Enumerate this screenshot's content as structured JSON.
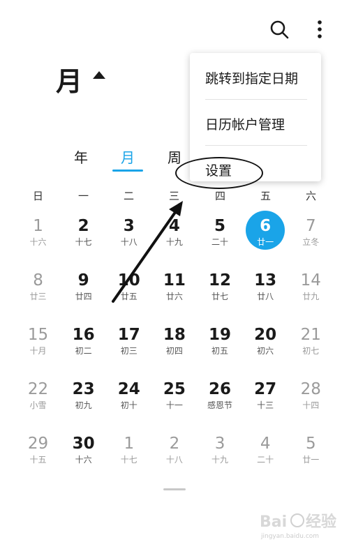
{
  "header": {
    "month_label": "月",
    "icons": [
      "search-icon",
      "more-vert-icon",
      "dropdown-caret-icon"
    ]
  },
  "view_tabs": [
    {
      "label": "年",
      "active": false
    },
    {
      "label": "月",
      "active": true
    },
    {
      "label": "周",
      "active": false
    }
  ],
  "weekdays": [
    "日",
    "一",
    "二",
    "三",
    "四",
    "五",
    "六"
  ],
  "menu": {
    "items": [
      "跳转到指定日期",
      "日历帐户管理",
      "设置"
    ]
  },
  "calendar": {
    "weeks": [
      [
        {
          "day": "1",
          "sub": "十六",
          "muted": true
        },
        {
          "day": "2",
          "sub": "十七"
        },
        {
          "day": "3",
          "sub": "十八"
        },
        {
          "day": "4",
          "sub": "十九"
        },
        {
          "day": "5",
          "sub": "二十"
        },
        {
          "day": "6",
          "sub": "廿一",
          "today": true
        },
        {
          "day": "7",
          "sub": "立冬",
          "muted": true
        }
      ],
      [
        {
          "day": "8",
          "sub": "廿三",
          "muted": true
        },
        {
          "day": "9",
          "sub": "廿四"
        },
        {
          "day": "10",
          "sub": "廿五"
        },
        {
          "day": "11",
          "sub": "廿六"
        },
        {
          "day": "12",
          "sub": "廿七"
        },
        {
          "day": "13",
          "sub": "廿八"
        },
        {
          "day": "14",
          "sub": "廿九",
          "muted": true
        }
      ],
      [
        {
          "day": "15",
          "sub": "十月",
          "muted": true
        },
        {
          "day": "16",
          "sub": "初二"
        },
        {
          "day": "17",
          "sub": "初三"
        },
        {
          "day": "18",
          "sub": "初四"
        },
        {
          "day": "19",
          "sub": "初五"
        },
        {
          "day": "20",
          "sub": "初六"
        },
        {
          "day": "21",
          "sub": "初七",
          "muted": true
        }
      ],
      [
        {
          "day": "22",
          "sub": "小雪",
          "muted": true
        },
        {
          "day": "23",
          "sub": "初九"
        },
        {
          "day": "24",
          "sub": "初十"
        },
        {
          "day": "25",
          "sub": "十一"
        },
        {
          "day": "26",
          "sub": "感恩节"
        },
        {
          "day": "27",
          "sub": "十三"
        },
        {
          "day": "28",
          "sub": "十四",
          "muted": true
        }
      ],
      [
        {
          "day": "29",
          "sub": "十五",
          "muted": true
        },
        {
          "day": "30",
          "sub": "十六"
        },
        {
          "day": "1",
          "sub": "十七",
          "muted": true
        },
        {
          "day": "2",
          "sub": "十八",
          "muted": true
        },
        {
          "day": "3",
          "sub": "十九",
          "muted": true
        },
        {
          "day": "4",
          "sub": "二十",
          "muted": true
        },
        {
          "day": "5",
          "sub": "廿一",
          "muted": true
        }
      ]
    ]
  },
  "colors": {
    "accent": "#1aa4e8",
    "muted_text": "#9a9a9a",
    "text": "#1a1a1a"
  },
  "watermark": {
    "text": "Bai经验",
    "subtext": "jingyan.baidu.com"
  }
}
